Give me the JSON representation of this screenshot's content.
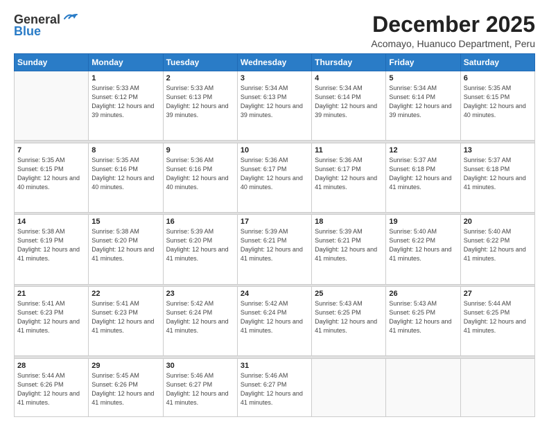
{
  "header": {
    "logo_general": "General",
    "logo_blue": "Blue",
    "month_title": "December 2025",
    "subtitle": "Acomayo, Huanuco Department, Peru"
  },
  "weekdays": [
    "Sunday",
    "Monday",
    "Tuesday",
    "Wednesday",
    "Thursday",
    "Friday",
    "Saturday"
  ],
  "weeks": [
    [
      {
        "day": "",
        "sunrise": "",
        "sunset": "",
        "daylight": ""
      },
      {
        "day": "1",
        "sunrise": "Sunrise: 5:33 AM",
        "sunset": "Sunset: 6:12 PM",
        "daylight": "Daylight: 12 hours and 39 minutes."
      },
      {
        "day": "2",
        "sunrise": "Sunrise: 5:33 AM",
        "sunset": "Sunset: 6:13 PM",
        "daylight": "Daylight: 12 hours and 39 minutes."
      },
      {
        "day": "3",
        "sunrise": "Sunrise: 5:34 AM",
        "sunset": "Sunset: 6:13 PM",
        "daylight": "Daylight: 12 hours and 39 minutes."
      },
      {
        "day": "4",
        "sunrise": "Sunrise: 5:34 AM",
        "sunset": "Sunset: 6:14 PM",
        "daylight": "Daylight: 12 hours and 39 minutes."
      },
      {
        "day": "5",
        "sunrise": "Sunrise: 5:34 AM",
        "sunset": "Sunset: 6:14 PM",
        "daylight": "Daylight: 12 hours and 39 minutes."
      },
      {
        "day": "6",
        "sunrise": "Sunrise: 5:35 AM",
        "sunset": "Sunset: 6:15 PM",
        "daylight": "Daylight: 12 hours and 40 minutes."
      }
    ],
    [
      {
        "day": "7",
        "sunrise": "Sunrise: 5:35 AM",
        "sunset": "Sunset: 6:15 PM",
        "daylight": "Daylight: 12 hours and 40 minutes."
      },
      {
        "day": "8",
        "sunrise": "Sunrise: 5:35 AM",
        "sunset": "Sunset: 6:16 PM",
        "daylight": "Daylight: 12 hours and 40 minutes."
      },
      {
        "day": "9",
        "sunrise": "Sunrise: 5:36 AM",
        "sunset": "Sunset: 6:16 PM",
        "daylight": "Daylight: 12 hours and 40 minutes."
      },
      {
        "day": "10",
        "sunrise": "Sunrise: 5:36 AM",
        "sunset": "Sunset: 6:17 PM",
        "daylight": "Daylight: 12 hours and 40 minutes."
      },
      {
        "day": "11",
        "sunrise": "Sunrise: 5:36 AM",
        "sunset": "Sunset: 6:17 PM",
        "daylight": "Daylight: 12 hours and 41 minutes."
      },
      {
        "day": "12",
        "sunrise": "Sunrise: 5:37 AM",
        "sunset": "Sunset: 6:18 PM",
        "daylight": "Daylight: 12 hours and 41 minutes."
      },
      {
        "day": "13",
        "sunrise": "Sunrise: 5:37 AM",
        "sunset": "Sunset: 6:18 PM",
        "daylight": "Daylight: 12 hours and 41 minutes."
      }
    ],
    [
      {
        "day": "14",
        "sunrise": "Sunrise: 5:38 AM",
        "sunset": "Sunset: 6:19 PM",
        "daylight": "Daylight: 12 hours and 41 minutes."
      },
      {
        "day": "15",
        "sunrise": "Sunrise: 5:38 AM",
        "sunset": "Sunset: 6:20 PM",
        "daylight": "Daylight: 12 hours and 41 minutes."
      },
      {
        "day": "16",
        "sunrise": "Sunrise: 5:39 AM",
        "sunset": "Sunset: 6:20 PM",
        "daylight": "Daylight: 12 hours and 41 minutes."
      },
      {
        "day": "17",
        "sunrise": "Sunrise: 5:39 AM",
        "sunset": "Sunset: 6:21 PM",
        "daylight": "Daylight: 12 hours and 41 minutes."
      },
      {
        "day": "18",
        "sunrise": "Sunrise: 5:39 AM",
        "sunset": "Sunset: 6:21 PM",
        "daylight": "Daylight: 12 hours and 41 minutes."
      },
      {
        "day": "19",
        "sunrise": "Sunrise: 5:40 AM",
        "sunset": "Sunset: 6:22 PM",
        "daylight": "Daylight: 12 hours and 41 minutes."
      },
      {
        "day": "20",
        "sunrise": "Sunrise: 5:40 AM",
        "sunset": "Sunset: 6:22 PM",
        "daylight": "Daylight: 12 hours and 41 minutes."
      }
    ],
    [
      {
        "day": "21",
        "sunrise": "Sunrise: 5:41 AM",
        "sunset": "Sunset: 6:23 PM",
        "daylight": "Daylight: 12 hours and 41 minutes."
      },
      {
        "day": "22",
        "sunrise": "Sunrise: 5:41 AM",
        "sunset": "Sunset: 6:23 PM",
        "daylight": "Daylight: 12 hours and 41 minutes."
      },
      {
        "day": "23",
        "sunrise": "Sunrise: 5:42 AM",
        "sunset": "Sunset: 6:24 PM",
        "daylight": "Daylight: 12 hours and 41 minutes."
      },
      {
        "day": "24",
        "sunrise": "Sunrise: 5:42 AM",
        "sunset": "Sunset: 6:24 PM",
        "daylight": "Daylight: 12 hours and 41 minutes."
      },
      {
        "day": "25",
        "sunrise": "Sunrise: 5:43 AM",
        "sunset": "Sunset: 6:25 PM",
        "daylight": "Daylight: 12 hours and 41 minutes."
      },
      {
        "day": "26",
        "sunrise": "Sunrise: 5:43 AM",
        "sunset": "Sunset: 6:25 PM",
        "daylight": "Daylight: 12 hours and 41 minutes."
      },
      {
        "day": "27",
        "sunrise": "Sunrise: 5:44 AM",
        "sunset": "Sunset: 6:25 PM",
        "daylight": "Daylight: 12 hours and 41 minutes."
      }
    ],
    [
      {
        "day": "28",
        "sunrise": "Sunrise: 5:44 AM",
        "sunset": "Sunset: 6:26 PM",
        "daylight": "Daylight: 12 hours and 41 minutes."
      },
      {
        "day": "29",
        "sunrise": "Sunrise: 5:45 AM",
        "sunset": "Sunset: 6:26 PM",
        "daylight": "Daylight: 12 hours and 41 minutes."
      },
      {
        "day": "30",
        "sunrise": "Sunrise: 5:46 AM",
        "sunset": "Sunset: 6:27 PM",
        "daylight": "Daylight: 12 hours and 41 minutes."
      },
      {
        "day": "31",
        "sunrise": "Sunrise: 5:46 AM",
        "sunset": "Sunset: 6:27 PM",
        "daylight": "Daylight: 12 hours and 41 minutes."
      },
      {
        "day": "",
        "sunrise": "",
        "sunset": "",
        "daylight": ""
      },
      {
        "day": "",
        "sunrise": "",
        "sunset": "",
        "daylight": ""
      },
      {
        "day": "",
        "sunrise": "",
        "sunset": "",
        "daylight": ""
      }
    ]
  ]
}
